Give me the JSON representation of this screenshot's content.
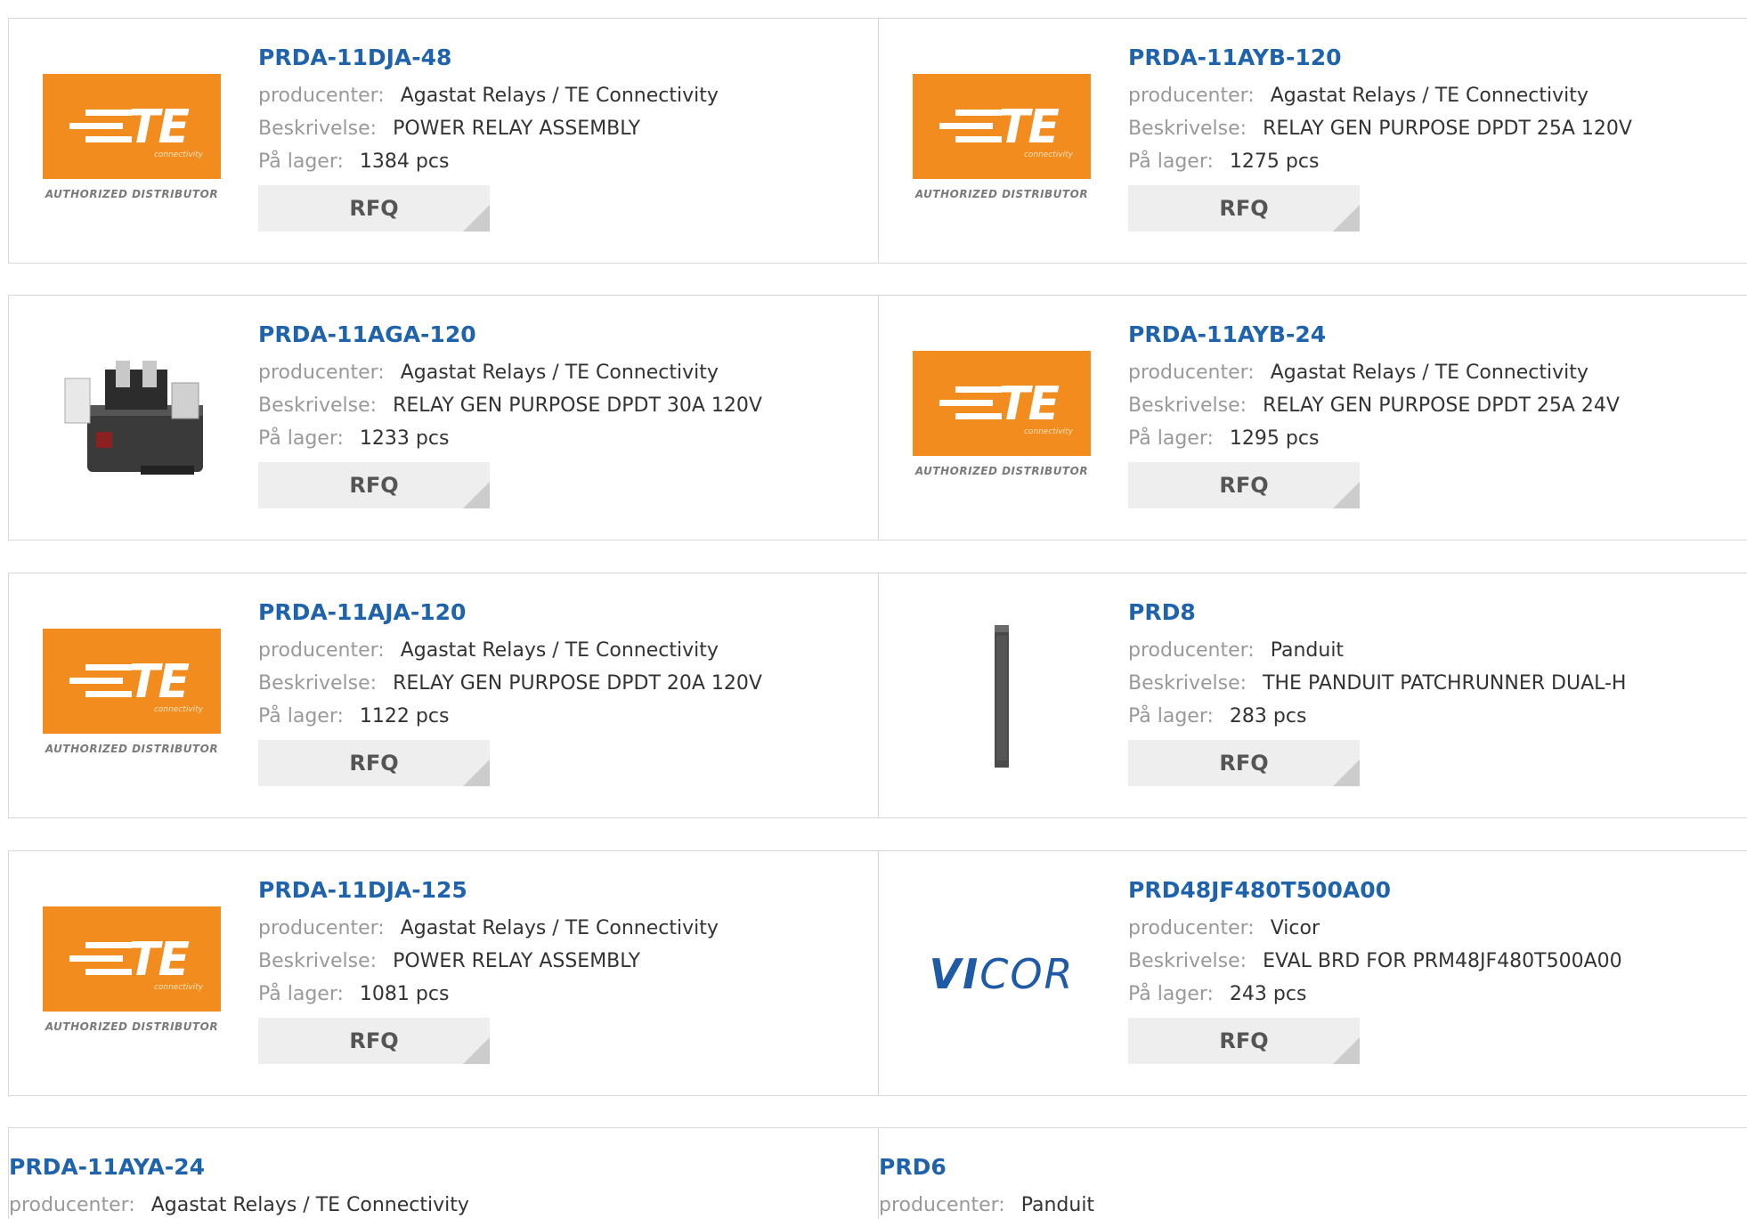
{
  "labels": {
    "manufacturer": "producenter:",
    "description": "Beskrivelse:",
    "stock": "På lager:",
    "rfq": "RFQ"
  },
  "logos": {
    "te_sub": "connectivity",
    "te_authorized": "AUTHORIZED DISTRIBUTOR",
    "te_letters": "TE",
    "vicor_bold": "VI",
    "vicor_rest": "COR"
  },
  "products": [
    {
      "part": "PRDA-11DJA-48",
      "manufacturer": "Agastat Relays / TE Connectivity",
      "description": "POWER RELAY ASSEMBLY",
      "stock": "1384 pcs",
      "image": "te-logo"
    },
    {
      "part": "PRDA-11AYB-120",
      "manufacturer": "Agastat Relays / TE Connectivity",
      "description": "RELAY GEN PURPOSE DPDT 25A 120V",
      "stock": "1275 pcs",
      "image": "te-logo"
    },
    {
      "part": "PRDA-11AGA-120",
      "manufacturer": "Agastat Relays / TE Connectivity",
      "description": "RELAY GEN PURPOSE DPDT 30A 120V",
      "stock": "1233 pcs",
      "image": "relay-photo"
    },
    {
      "part": "PRDA-11AYB-24",
      "manufacturer": "Agastat Relays / TE Connectivity",
      "description": "RELAY GEN PURPOSE DPDT 25A 24V",
      "stock": "1295 pcs",
      "image": "te-logo"
    },
    {
      "part": "PRDA-11AJA-120",
      "manufacturer": "Agastat Relays / TE Connectivity",
      "description": "RELAY GEN PURPOSE DPDT 20A 120V",
      "stock": "1122 pcs",
      "image": "te-logo"
    },
    {
      "part": "PRD8",
      "manufacturer": "Panduit",
      "description": "THE PANDUIT PATCHRUNNER DUAL-H",
      "stock": "283 pcs",
      "image": "panduit-bar"
    },
    {
      "part": "PRDA-11DJA-125",
      "manufacturer": "Agastat Relays / TE Connectivity",
      "description": "POWER RELAY ASSEMBLY",
      "stock": "1081 pcs",
      "image": "te-logo"
    },
    {
      "part": "PRD48JF480T500A00",
      "manufacturer": "Vicor",
      "description": "EVAL BRD FOR PRM48JF480T500A00",
      "stock": "243 pcs",
      "image": "vicor-logo"
    },
    {
      "part": "PRDA-11AYA-24",
      "manufacturer": "Agastat Relays / TE Connectivity"
    },
    {
      "part": "PRD6",
      "manufacturer": "Panduit"
    }
  ]
}
